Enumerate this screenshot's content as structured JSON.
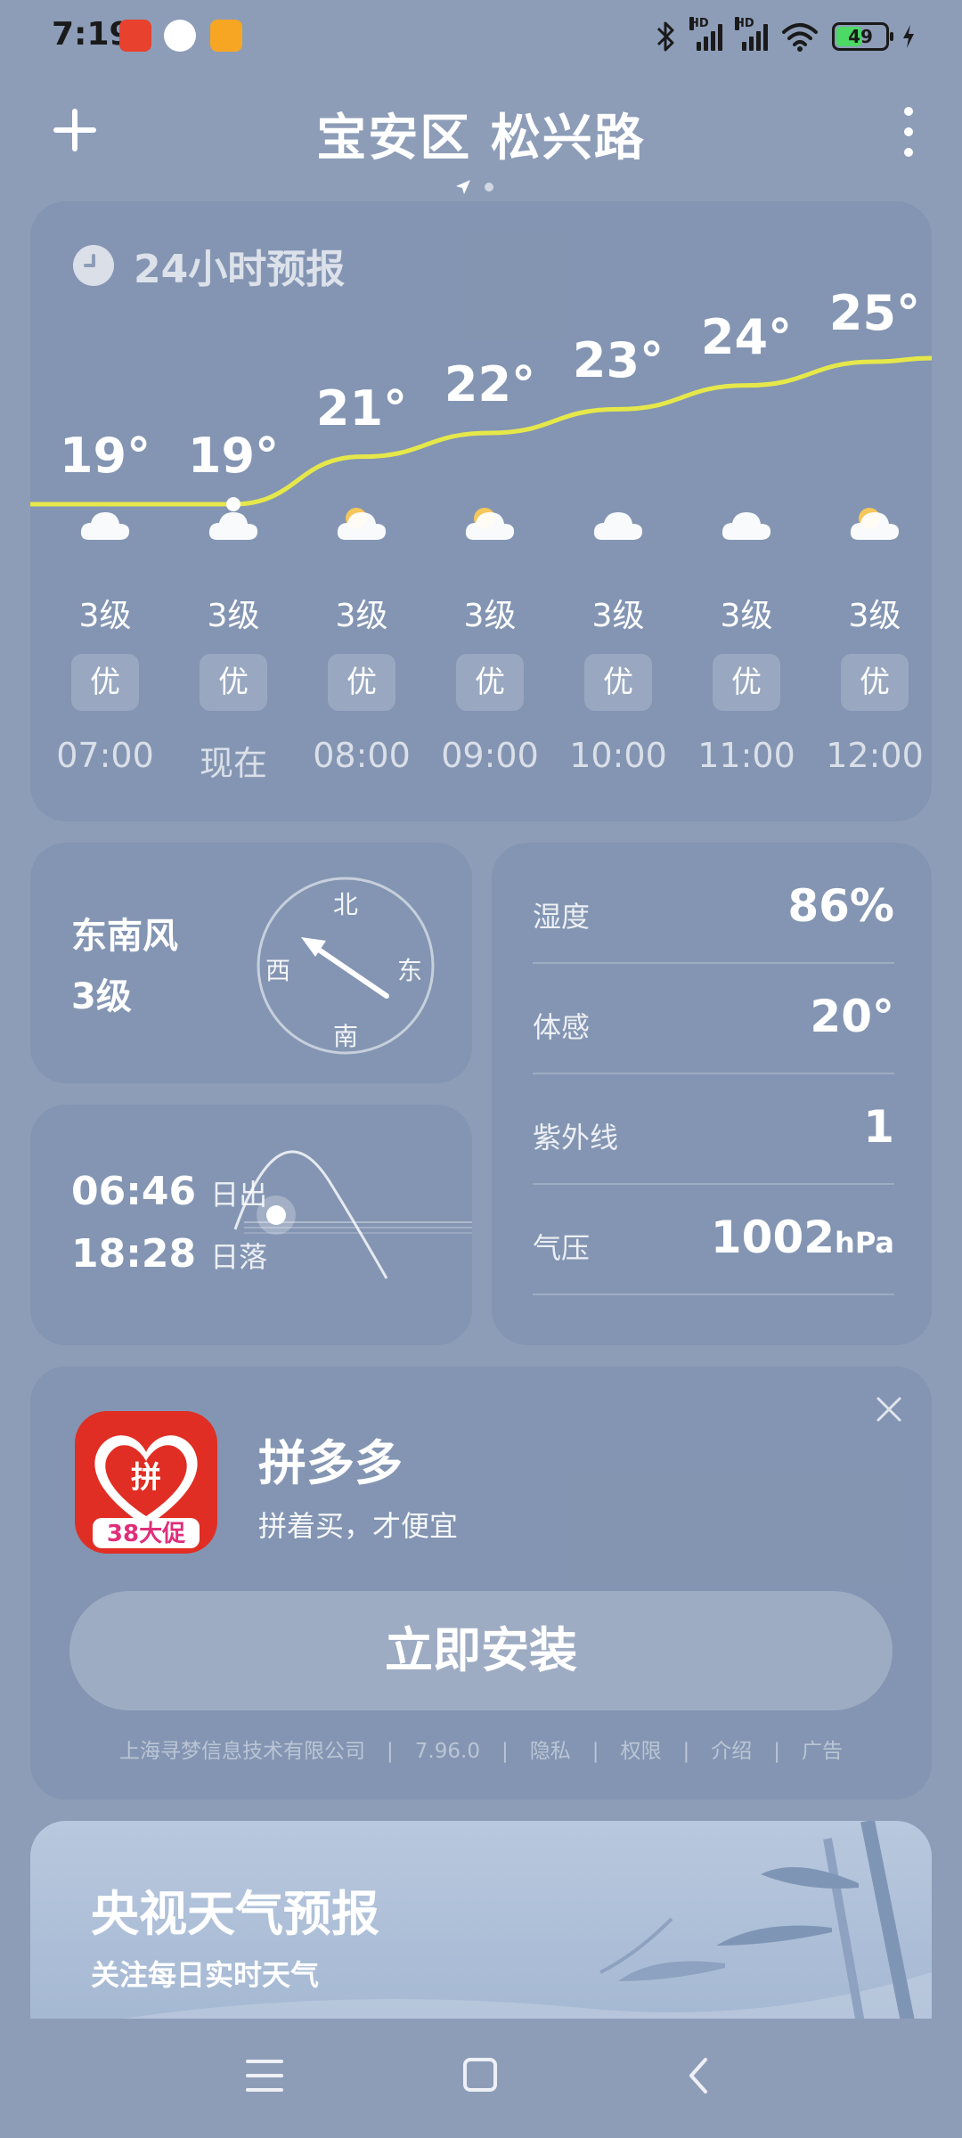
{
  "status": {
    "time": "7:19",
    "battery": "49",
    "signal_label_1": "HD",
    "signal_label_2": "HD"
  },
  "header": {
    "location": "宝安区 松兴路"
  },
  "hourly": {
    "title": "24小时预报",
    "hours": [
      {
        "time": "07:00",
        "temp": "19°",
        "wind": "3级",
        "aqi": "优",
        "icon": "cloud-icon",
        "temp_value": 19
      },
      {
        "time": "现在",
        "temp": "19°",
        "wind": "3级",
        "aqi": "优",
        "icon": "cloud-icon",
        "temp_value": 19
      },
      {
        "time": "08:00",
        "temp": "21°",
        "wind": "3级",
        "aqi": "优",
        "icon": "partly-sunny-icon",
        "temp_value": 21
      },
      {
        "time": "09:00",
        "temp": "22°",
        "wind": "3级",
        "aqi": "优",
        "icon": "partly-sunny-icon",
        "temp_value": 22
      },
      {
        "time": "10:00",
        "temp": "23°",
        "wind": "3级",
        "aqi": "优",
        "icon": "cloud-icon",
        "temp_value": 23
      },
      {
        "time": "11:00",
        "temp": "24°",
        "wind": "3级",
        "aqi": "优",
        "icon": "cloud-icon",
        "temp_value": 24
      },
      {
        "time": "12:00",
        "temp": "25°",
        "wind": "3级",
        "aqi": "优",
        "icon": "partly-sunny-icon",
        "temp_value": 25
      }
    ],
    "line_color": "#e6e84a"
  },
  "wind": {
    "direction": "东南风",
    "level": "3级",
    "compass": {
      "n": "北",
      "s": "南",
      "e": "东",
      "w": "西"
    }
  },
  "sun": {
    "sunrise_time": "06:46",
    "sunrise_label": "日出",
    "sunset_time": "18:28",
    "sunset_label": "日落"
  },
  "details": [
    {
      "label": "湿度",
      "value": "86%",
      "unit": ""
    },
    {
      "label": "体感",
      "value": "20°",
      "unit": ""
    },
    {
      "label": "紫外线",
      "value": "1",
      "unit": ""
    },
    {
      "label": "气压",
      "value": "1002",
      "unit": "hPa"
    }
  ],
  "ad": {
    "app_name": "拼多多",
    "slogan": "拼着买，才便宜",
    "logo_char": "拼",
    "logo_badge": "38大促",
    "install_label": "立即安装",
    "footer": [
      "上海寻梦信息技术有限公司",
      "|",
      "7.96.0",
      "|",
      "隐私",
      "|",
      "权限",
      "|",
      "介绍",
      "|",
      "广告"
    ]
  },
  "cctv": {
    "title": "央视天气预报",
    "subtitle": "关注每日实时天气"
  }
}
